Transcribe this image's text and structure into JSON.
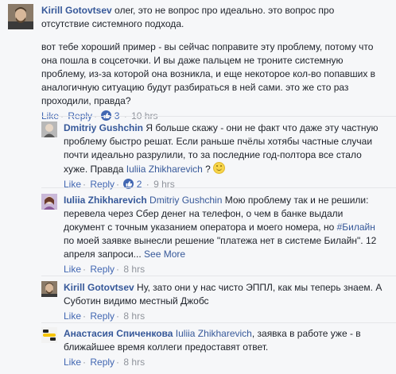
{
  "comments": [
    {
      "author": "Kirill Gotovtsev",
      "para1": "олег, это не вопрос про идеально. это вопрос про отсутствие системного подхода.",
      "para2": "вот тебе хороший пример - вы сейчас поправите эту проблему, потому что она пошла в соцсеточки. И вы даже пальцем не троните системную проблему, из-за которой она возникла, и еще некоторое кол-во попавших в аналогичную ситуацию будут разбираться в ней сами. это же сто раз проходили, правда?",
      "like": "Like",
      "reply": "Reply",
      "reactions": "3",
      "time": "10 hrs"
    },
    {
      "author": "Dmitriy Gushchin",
      "text": "Я больше скажу - они не факт что даже эту частную проблему быстро решат. Если раньше пчёлы хотябы частные случаи почти идеально разрулили, то за последние год-полтора все стало хуже. Правда",
      "mention": "Iuliia Zhikharevich",
      "after_mention": "?",
      "like": "Like",
      "reply": "Reply",
      "reactions": "2",
      "time": "9 hrs"
    },
    {
      "author": "Iuliia Zhikharevich",
      "mention": "Dmitriy Gushchin",
      "text1": "Мою проблему так и не решили: перевела через Сбер денег на телефон, о чем в банке выдали документ с точным указанием оператора и моего номера, но",
      "hashtag": "#Билайн",
      "text2": "по моей заявке вынесли решение \"платежа нет в системе Билайн\". 12 апреля запроси...",
      "see_more": "See More",
      "like": "Like",
      "reply": "Reply",
      "time": "8 hrs"
    },
    {
      "author": "Kirill Gotovtsev",
      "text": "Ну, зато они у нас чисто ЭППЛ, как мы теперь знаем. А Суботин видимо местный Джобс",
      "like": "Like",
      "reply": "Reply",
      "time": "8 hrs"
    },
    {
      "author": "Анастасия Спиченкова",
      "mention": "Iuliia Zhikharevich",
      "text": ", заявка в работе уже - в ближайшее время коллеги предоставят ответ.",
      "like": "Like",
      "reply": "Reply",
      "time": "8 hrs"
    }
  ],
  "colors": {
    "link": "#365899",
    "meta": "#90949c",
    "background": "#f6f7f9"
  }
}
